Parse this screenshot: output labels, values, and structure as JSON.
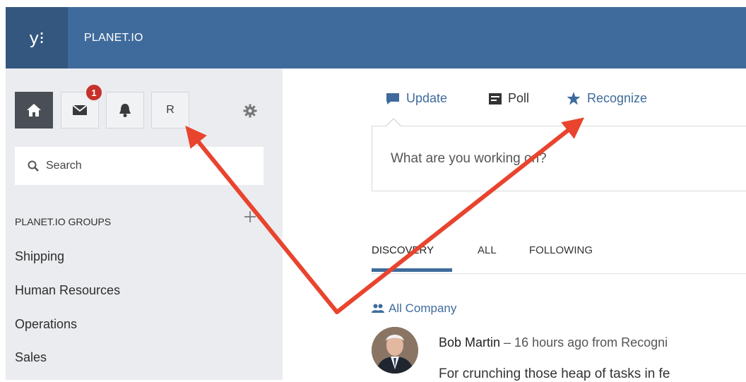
{
  "header": {
    "logo_text": "y⁝",
    "network_name": "PLANET.IO",
    "background_color": "#3f6b9c"
  },
  "sidebar": {
    "icons": [
      "home-icon",
      "mail-icon",
      "bell-icon",
      "profile-button",
      "gear-icon"
    ],
    "profile_initial": "R",
    "notification_count": "1",
    "search_placeholder": "Search",
    "groups_heading": "PLANET.IO GROUPS",
    "groups": [
      "Shipping",
      "Human Resources",
      "Operations",
      "Sales"
    ]
  },
  "publisher": {
    "tabs": [
      {
        "label": "Update",
        "icon": "speech-bubble-icon"
      },
      {
        "label": "Poll",
        "icon": "poll-icon"
      },
      {
        "label": "Recognize",
        "icon": "star-icon"
      }
    ],
    "placeholder": "What are you working on?"
  },
  "feed": {
    "tabs": [
      "DISCOVERY",
      "ALL",
      "FOLLOWING"
    ],
    "active_tab": "DISCOVERY",
    "group_tag": "All Company",
    "post": {
      "author": "Bob Martin",
      "meta": " – 16 hours ago from Recogni",
      "body": "For crunching those heap of tasks in fe"
    }
  },
  "annotation": {
    "arrow_color": "#e8442e"
  }
}
